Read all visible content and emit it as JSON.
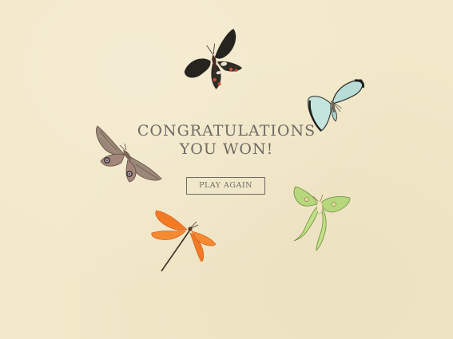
{
  "screen": {
    "background_color": "#f2e8c9",
    "text_color": "#6f6a62"
  },
  "message": {
    "line1": "CONGRATULATIONS",
    "line2": "YOU WON!"
  },
  "play_again_button": {
    "label": "PLAY AGAIN"
  },
  "insects": [
    {
      "name": "black-swallowtail-butterfly-icon",
      "color": "#2b2a22"
    },
    {
      "name": "pale-blue-butterfly-icon",
      "color": "#b9dcd8"
    },
    {
      "name": "brown-moth-icon",
      "color": "#8a7566"
    },
    {
      "name": "orange-dragonfly-icon",
      "color": "#f27a24"
    },
    {
      "name": "green-luna-moth-icon",
      "color": "#b6d77c"
    }
  ]
}
